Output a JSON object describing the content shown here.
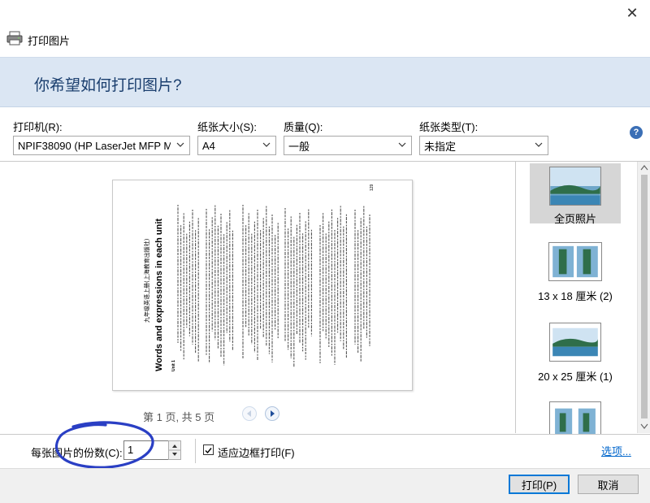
{
  "window": {
    "title": "打印图片",
    "close_glyph": "✕"
  },
  "header": {
    "heading": "你希望如何打印图片?"
  },
  "settings": {
    "printer": {
      "label": "打印机(R):",
      "value": "NPIF38090 (HP LaserJet MFP M"
    },
    "paper_size": {
      "label": "纸张大小(S):",
      "value": "A4"
    },
    "quality": {
      "label": "质量(Q):",
      "value": "一般"
    },
    "paper_type": {
      "label": "纸张类型(T):",
      "value": "未指定"
    },
    "help_glyph": "?"
  },
  "preview": {
    "page_info": "第 1 页, 共 5 页",
    "document_title": "Words and expressions in each unit",
    "document_subtitle": "九年级英语上册(上海教育出版社)",
    "unit_label": "Unit 1",
    "page_number": "129"
  },
  "layouts": [
    {
      "label": "全页照片",
      "selected": true
    },
    {
      "label": "13 x 18 厘米 (2)",
      "selected": false
    },
    {
      "label": "20 x 25 厘米 (1)",
      "selected": false
    },
    {
      "label": "",
      "selected": false
    }
  ],
  "copies": {
    "label": "每张图片的份数(C):",
    "value": "1"
  },
  "fit_to_frame": {
    "label": "适应边框打印(F)",
    "checked": true
  },
  "options_link": "选项...",
  "buttons": {
    "print": "打印(P)",
    "cancel": "取消"
  },
  "colors": {
    "banner": "#dbe6f3",
    "heading": "#1a3e6e",
    "accent": "#0078d7",
    "annotation": "#2a3fc4"
  }
}
